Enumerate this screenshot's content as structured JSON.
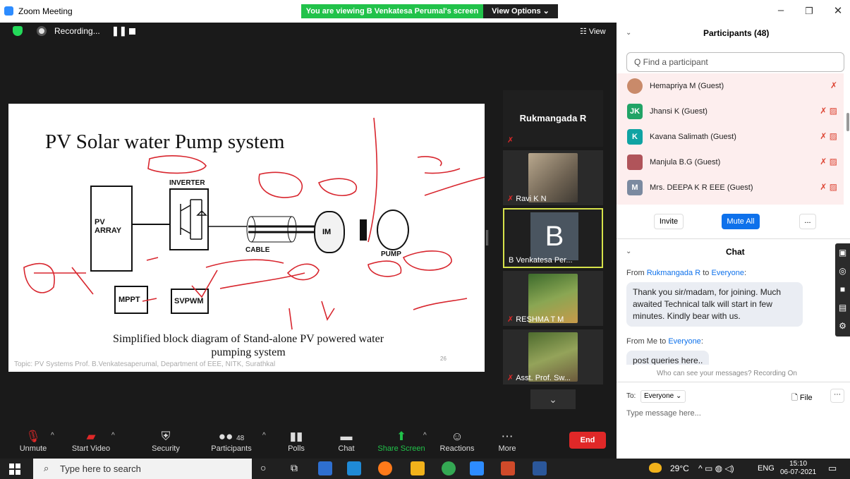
{
  "window": {
    "title": "Zoom Meeting",
    "share_banner": "You are viewing B Venkatesa Perumal's screen",
    "view_options": "View Options ⌄"
  },
  "recording": {
    "label": "Recording..."
  },
  "view_btn": "☷ View",
  "slide": {
    "title": "PV Solar water Pump system",
    "blocks": {
      "pv_array": "PV ARRAY",
      "inverter": "INVERTER",
      "im": "IM",
      "cable": "CABLE",
      "pump": "PUMP",
      "mppt": "MPPT",
      "svpwm": "SVPWM"
    },
    "caption": "Simplified block diagram of Stand-alone PV powered water pumping system",
    "footer": "Topic: PV Systems  Prof. B.Venkatesaperumal, Department of EEE, NITK, Surathkal",
    "page": "26"
  },
  "video_tiles": [
    {
      "name": "Rukmangada R"
    },
    {
      "name": "Ravi K N"
    },
    {
      "name": "B Venkatesa Per...",
      "initial": "B"
    },
    {
      "name": "RESHMA T M"
    },
    {
      "name": "Asst. Prof. Sw..."
    }
  ],
  "toolbar": {
    "unmute": "Unmute",
    "start_video": "Start Video",
    "security": "Security",
    "participants": "Participants",
    "participants_count": "48",
    "polls": "Polls",
    "chat": "Chat",
    "share_screen": "Share Screen",
    "reactions": "Reactions",
    "more": "More",
    "end": "End"
  },
  "participants": {
    "title": "Participants (48)",
    "search_placeholder": "Q Find a participant",
    "items": [
      {
        "name": "Hemapriya M (Guest)",
        "initials": "",
        "color": "#c98a6a"
      },
      {
        "name": "Jhansi K (Guest)",
        "initials": "JK",
        "color": "#21a366"
      },
      {
        "name": "Kavana Salimath (Guest)",
        "initials": "K",
        "color": "#0fa3a3"
      },
      {
        "name": "Manjula B.G (Guest)",
        "initials": "",
        "color": "#b0545a"
      },
      {
        "name": "Mrs. DEEPA K R EEE (Guest)",
        "initials": "M",
        "color": "#7b8aa0"
      }
    ],
    "invite": "Invite",
    "mute_all": "Mute All",
    "more": "..."
  },
  "chat": {
    "title": "Chat",
    "messages": [
      {
        "from": "Rukmangada R",
        "to": "Everyone",
        "text": "Thank you sir/madam, for joining. Much awaited Technical talk will start in few minutes. Kindly bear with us."
      },
      {
        "from": "Me",
        "to": "Everyone",
        "text": "post queries here.."
      }
    ],
    "from_word": "From",
    "to_word": "to",
    "notice": "Who can see your messages? Recording On",
    "to_label": "To:",
    "to_value": "Everyone ⌄",
    "file": "File",
    "placeholder": "Type message here..."
  },
  "taskbar": {
    "search_placeholder": "Type here to search",
    "weather": "29°C",
    "lang": "ENG",
    "time": "15:10",
    "date": "06-07-2021"
  },
  "colors": {
    "accent": "#0e71eb",
    "banner": "#21c24a",
    "end": "#e02828"
  }
}
